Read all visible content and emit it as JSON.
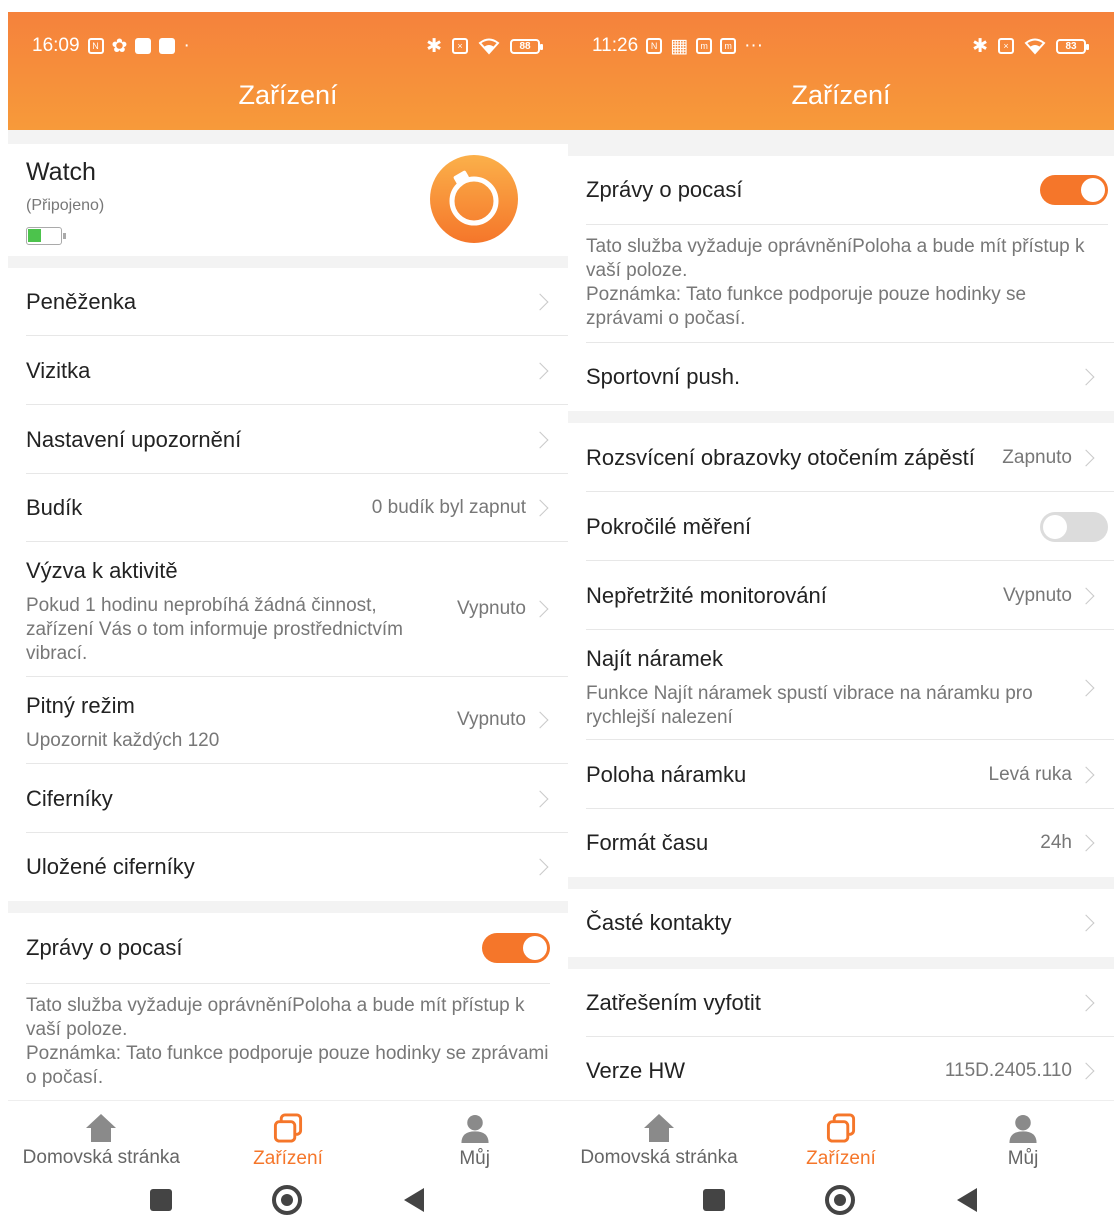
{
  "left": {
    "status": {
      "time": "16:09",
      "battery": "88"
    },
    "header": {
      "title": "Zařízení"
    },
    "device": {
      "name": "Watch",
      "status": "(Připojeno)"
    },
    "rows": [
      {
        "label": "Peněženka"
      },
      {
        "label": "Vizitka"
      },
      {
        "label": "Nastavení upozornění"
      },
      {
        "label": "Budík",
        "value": "0 budík byl zapnut"
      },
      {
        "label": "Výzva k aktivitě",
        "desc": "Pokud 1 hodinu neprobíhá žádná činnost, zařízení Vás o tom informuje prostřednictvím vibrací.",
        "value": "Vypnuto"
      },
      {
        "label": "Pitný režim",
        "desc": "Upozornit každých 120",
        "value": "Vypnuto"
      },
      {
        "label": "Ciferníky"
      },
      {
        "label": "Uložené ciferníky"
      }
    ],
    "weather": {
      "label": "Zprávy o pocasí",
      "desc1": "Tato služba vyžaduje oprávněníPoloha a bude mít přístup k vaší poloze.",
      "desc2": "Poznámka: Tato funkce podporuje pouze hodinky se zprávami o počasí."
    },
    "nav": {
      "home": "Domovská stránka",
      "device": "Zařízení",
      "me": "Můj"
    }
  },
  "right": {
    "status": {
      "time": "11:26",
      "battery": "83"
    },
    "header": {
      "title": "Zařízení"
    },
    "weather": {
      "label": "Zprávy o pocasí",
      "desc1": "Tato služba vyžaduje oprávněníPoloha a bude mít přístup k vaší poloze.",
      "desc2": "Poznámka: Tato funkce podporuje pouze hodinky se zprávami o počasí."
    },
    "sport": {
      "label": "Sportovní push."
    },
    "rows1": [
      {
        "label": "Rozsvícení obrazovky otočením zápěstí",
        "value": "Zapnuto"
      },
      {
        "label": "Pokročilé měření"
      },
      {
        "label": "Nepřetržité monitorování",
        "value": "Vypnuto"
      },
      {
        "label": "Najít náramek",
        "desc": "Funkce Najít náramek spustí vibrace na náramku pro rychlejší nalezení"
      },
      {
        "label": "Poloha náramku",
        "value": "Levá ruka"
      },
      {
        "label": "Formát času",
        "value": "24h"
      }
    ],
    "contacts": {
      "label": "Časté kontakty"
    },
    "rows2": [
      {
        "label": "Zatřešením vyfotit"
      },
      {
        "label": "Verze HW",
        "value": "115D.2405.110"
      }
    ],
    "nav": {
      "home": "Domovská stránka",
      "device": "Zařízení",
      "me": "Můj"
    }
  },
  "colors": {
    "accent": "#f5762a",
    "header": "#f5823c"
  }
}
